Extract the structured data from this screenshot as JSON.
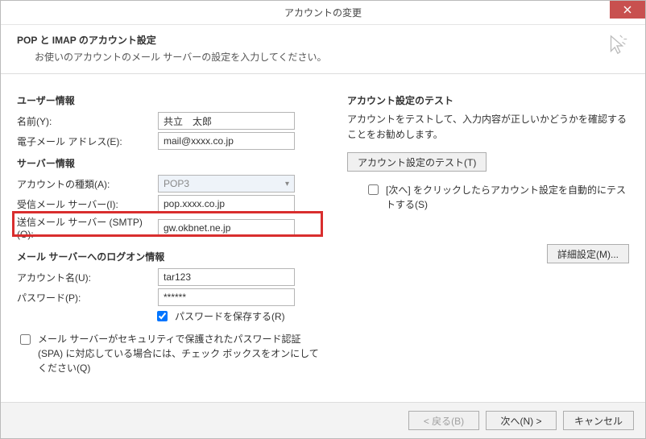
{
  "window": {
    "title": "アカウントの変更"
  },
  "header": {
    "title": "POP と IMAP のアカウント設定",
    "desc": "お使いのアカウントのメール サーバーの設定を入力してください。"
  },
  "sections": {
    "user": "ユーザー情報",
    "server": "サーバー情報",
    "logon": "メール サーバーへのログオン情報",
    "test": "アカウント設定のテスト"
  },
  "labels": {
    "name": "名前(Y):",
    "email": "電子メール アドレス(E):",
    "accountType": "アカウントの種類(A):",
    "incoming": "受信メール サーバー(I):",
    "outgoing": "送信メール サーバー (SMTP)(O):",
    "account": "アカウント名(U):",
    "password": "パスワード(P):",
    "savePassword": "パスワードを保存する(R)",
    "spa": "メール サーバーがセキュリティで保護されたパスワード認証 (SPA) に対応している場合には、チェック ボックスをオンにしてください(Q)",
    "testDesc": "アカウントをテストして、入力内容が正しいかどうかを確認することをお勧めします。",
    "autoTest": "[次へ] をクリックしたらアカウント設定を自動的にテストする(S)"
  },
  "values": {
    "name": "共立　太郎",
    "email": "mail@xxxx.co.jp",
    "accountType": "POP3",
    "incoming": "pop.xxxx.co.jp",
    "outgoing": "gw.okbnet.ne.jp",
    "account": "tar123",
    "password": "******"
  },
  "buttons": {
    "testAccount": "アカウント設定のテスト(T)",
    "details": "詳細設定(M)...",
    "back": "< 戻る(B)",
    "next": "次へ(N) >",
    "cancel": "キャンセル"
  }
}
